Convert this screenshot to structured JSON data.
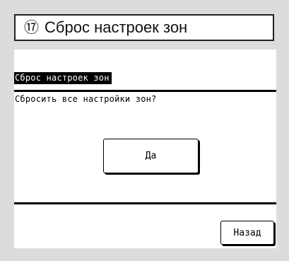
{
  "title": {
    "number": "⑰",
    "text": "Сброс настроек зон"
  },
  "screen": {
    "header": "Сброс настроек зон",
    "question": "Сбросить все настройки зон?",
    "yes_label": "Да",
    "back_label": "Назад"
  }
}
